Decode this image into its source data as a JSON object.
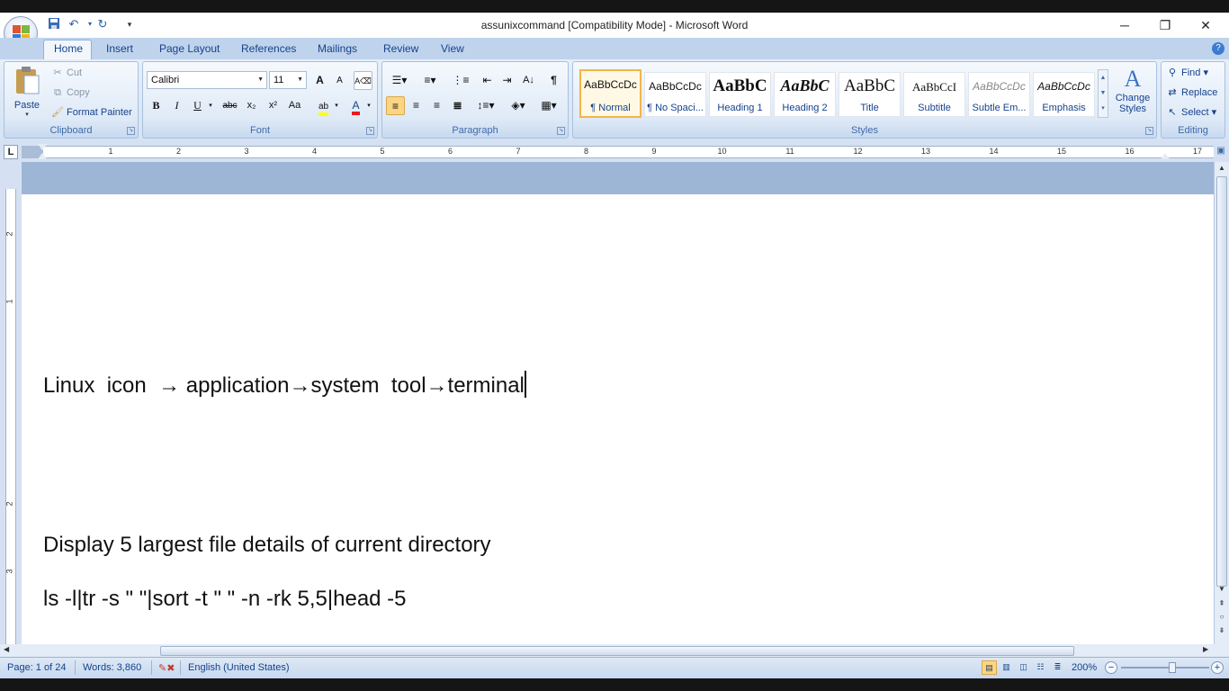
{
  "window": {
    "title": "assunixcommand [Compatibility Mode] - Microsoft Word",
    "minimize": "─",
    "restore": "❐",
    "close": "✕"
  },
  "quick_access": {
    "save_icon": "save-icon",
    "undo_icon": "undo-icon",
    "redo_icon": "redo-icon",
    "customize_icon": "chevron-down-icon"
  },
  "tabs": [
    "Home",
    "Insert",
    "Page Layout",
    "References",
    "Mailings",
    "Review",
    "View"
  ],
  "help": "?",
  "clipboard": {
    "paste": "Paste",
    "cut": "Cut",
    "copy": "Copy",
    "format_painter": "Format Painter",
    "label": "Clipboard"
  },
  "font": {
    "name": "Calibri",
    "size": "11",
    "grow": "A",
    "shrink": "A",
    "bold": "B",
    "italic": "I",
    "underline": "U",
    "strike": "abc",
    "subscript": "x₂",
    "superscript": "x²",
    "case": "Aa",
    "label": "Font"
  },
  "paragraph": {
    "pilcrow": "¶",
    "label": "Paragraph"
  },
  "styles": {
    "items": [
      {
        "sample": "AaBbCcDc",
        "name": "¶ Normal"
      },
      {
        "sample": "AaBbCcDc",
        "name": "¶ No Spaci..."
      },
      {
        "sample": "AaBbC",
        "name": "Heading 1"
      },
      {
        "sample": "AaBbC",
        "name": "Heading 2"
      },
      {
        "sample": "AaBbC",
        "name": "Title"
      },
      {
        "sample": "AaBbCcI",
        "name": "Subtitle"
      },
      {
        "sample": "AaBbCcDc",
        "name": "Subtle Em..."
      },
      {
        "sample": "AaBbCcDc",
        "name": "Emphasis"
      }
    ],
    "change_styles_line1": "Change",
    "change_styles_line2": "Styles",
    "label": "Styles"
  },
  "editing": {
    "find": "Find",
    "replace": "Replace",
    "select": "Select",
    "label": "Editing"
  },
  "ruler": {
    "tab_selector": "L",
    "numbers": [
      "1",
      "2",
      "3",
      "4",
      "5",
      "6",
      "7",
      "8",
      "9",
      "10",
      "11",
      "12",
      "13",
      "14",
      "15",
      "16",
      "17"
    ]
  },
  "vertical_ruler": {
    "numbers": [
      "2",
      "1",
      "2",
      "3"
    ]
  },
  "document": {
    "line1": "Linux  icon  → application→system  tool→terminal",
    "line2": "Display 5 largest file details of current directory",
    "line3": "ls -l|tr -s \" \"|sort -t \" \" -n -rk 5,5|head -5"
  },
  "status": {
    "page": "Page: 1 of 24",
    "words": "Words: 3,860",
    "language": "English (United States)",
    "zoom": "200%"
  }
}
